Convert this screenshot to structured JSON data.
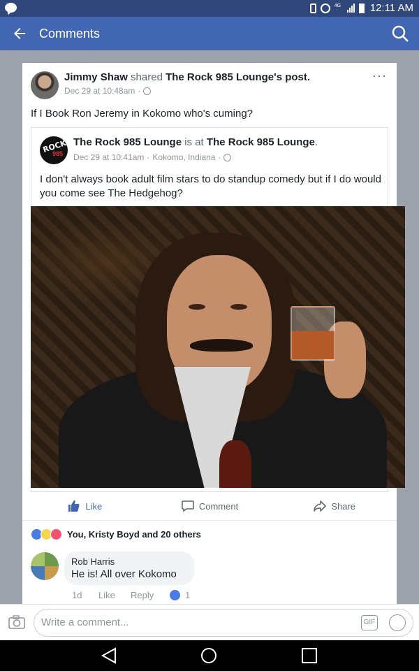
{
  "status_bar": {
    "time": "12:11 AM",
    "network": "4G"
  },
  "app_bar": {
    "title": "Comments"
  },
  "post": {
    "author": "Jimmy Shaw",
    "action_text": " shared ",
    "shared_from": "The Rock 985 Lounge",
    "shared_suffix": "'s post.",
    "date": "Dec 29 at 10:48am",
    "text": "If I Book Ron Jeremy in Kokomo who's cuming?",
    "shared_post": {
      "page": "The Rock 985 Lounge",
      "is_at": " is at ",
      "place": "The Rock 985 Lounge",
      "place_suffix": ".",
      "date": "Dec 29 at 10:41am",
      "location": "Kokomo, Indiana",
      "text": "I don't always book adult film stars to do standup comedy but if I do would you come see The Hedgehog?",
      "avatar_text": "ROCK",
      "avatar_subtext": "985"
    },
    "actions": {
      "like": "Like",
      "comment": "Comment",
      "share": "Share"
    },
    "reactions_text": "You, Kristy Boyd and 20 others"
  },
  "comment": {
    "author": "Rob Harris",
    "text": "He is! All over Kokomo",
    "time": "1d",
    "like": "Like",
    "reply": "Reply",
    "like_count": "1"
  },
  "composer": {
    "placeholder": "Write a comment...",
    "gif_label": "GIF"
  },
  "colors": {
    "app_bar": "#4267b2",
    "status_bar": "#2f477a",
    "like_blue": "#4267b2"
  }
}
